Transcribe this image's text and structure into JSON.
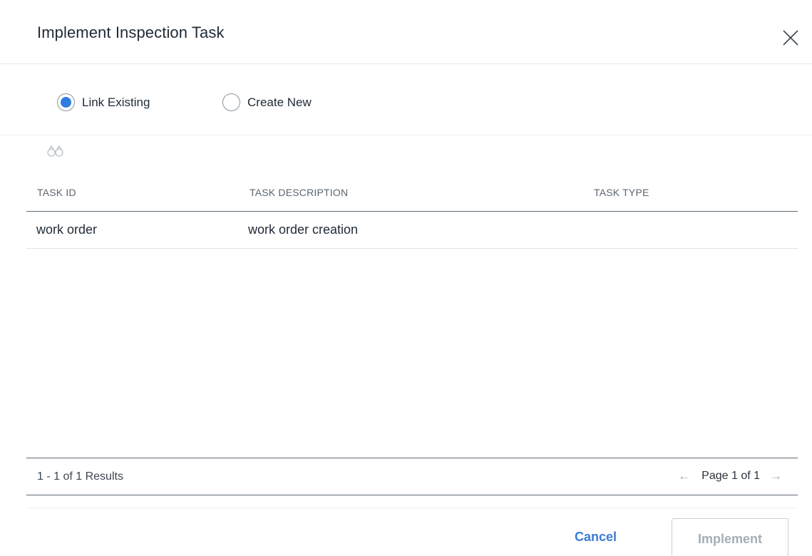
{
  "dialog": {
    "title": "Implement Inspection Task",
    "close_icon": "close-icon"
  },
  "mode": {
    "options": [
      {
        "label": "Link Existing",
        "selected": true
      },
      {
        "label": "Create New",
        "selected": false
      }
    ],
    "accent_color": "#2f7ce0"
  },
  "search": {
    "icon": "binoculars-icon"
  },
  "table": {
    "columns": [
      "TASK ID",
      "TASK DESCRIPTION",
      "TASK TYPE"
    ],
    "rows": [
      {
        "task_id": "work order",
        "task_description": "work order creation",
        "task_type": ""
      }
    ]
  },
  "pager": {
    "results_text": "1 - 1 of 1 Results",
    "page_text": "Page 1 of 1",
    "prev_icon": "arrow-left-icon",
    "next_icon": "arrow-right-icon"
  },
  "actions": {
    "cancel_label": "Cancel",
    "implement_label": "Implement",
    "implement_enabled": false,
    "link_color": "#3a7bd5"
  }
}
